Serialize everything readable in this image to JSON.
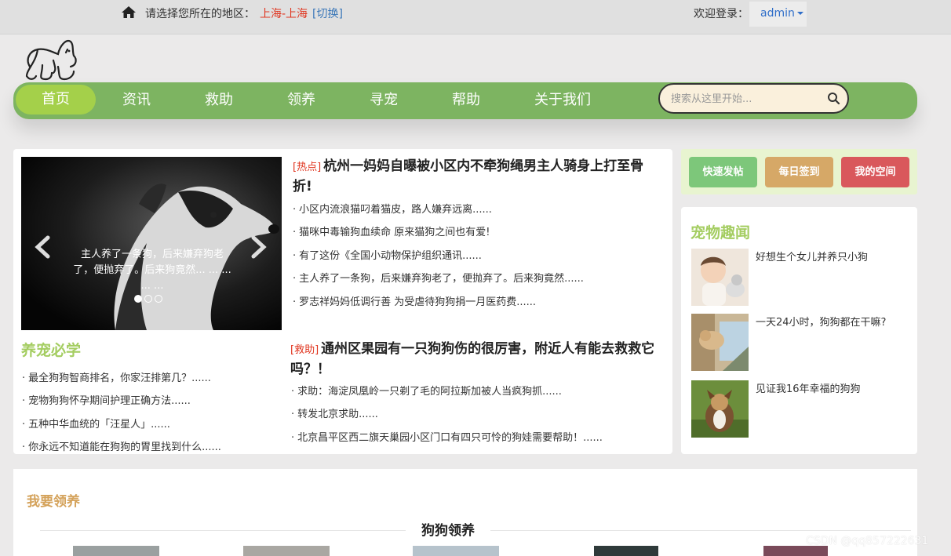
{
  "topbar": {
    "region_label": "请选择您所在的地区：",
    "region_value": "上海-上海",
    "region_switch": "[切换]",
    "welcome": "欢迎登录：",
    "username": "admin"
  },
  "nav": {
    "items": [
      "首页",
      "资讯",
      "救助",
      "领养",
      "寻宠",
      "帮助",
      "关于我们"
    ],
    "active": "首页",
    "search_placeholder": "搜索从这里开始..."
  },
  "carousel": {
    "caption": "主人养了一条狗，后来嫌弃狗老了，便抛弃了。后来狗竟然... ... ... ... ..."
  },
  "must_learn": {
    "title": "养宠必学",
    "items": [
      "最全狗狗智商排名，你家汪排第几？......",
      "宠物狗狗怀孕期间护理正确方法......",
      "五种中华血统的「汪星人」......",
      "你永远不知道能在狗狗的胃里找到什么......"
    ]
  },
  "hot": {
    "tag": "[热点]",
    "headline": "杭州一妈妈自曝被小区内不牵狗绳男主人骑身上打至骨折!",
    "items": [
      "小区内流浪猫叼着猫皮，路人嫌弃远离......",
      "猫咪中毒输狗血续命 原来猫狗之间也有爱!",
      "有了这份《全国小动物保护组织通讯......",
      "主人养了一条狗，后来嫌弃狗老了，便抛弃了。后来狗竟然......",
      "罗志祥妈妈低调行善 为受虐待狗狗捐一月医药费......"
    ]
  },
  "rescue": {
    "tag": "[救助]",
    "headline": "通州区果园有一只狗狗伤的很厉害，附近人有能去救救它吗？！",
    "items": [
      "求助：海淀凤凰岭一只剃了毛的阿拉斯加被人当疯狗抓......",
      "转发北京求助......",
      "北京昌平区西二旗天巢园小区门口有四只可怜的狗娃需要帮助！......"
    ]
  },
  "actions": {
    "quick_post": "快速发帖",
    "daily_checkin": "每日签到",
    "my_space": "我的空间",
    "colors": {
      "quick_post": "#7dc77a",
      "daily_checkin": "#d6a867",
      "my_space": "#d9585c"
    }
  },
  "pet_news": {
    "title": "宠物趣闻",
    "items": [
      "好想生个女儿并养只小狗",
      "一天24小时，狗狗都在干嘛?",
      "见证我16年幸福的狗狗"
    ]
  },
  "adopt": {
    "title": "我要领养",
    "subtitle": "狗狗领养"
  },
  "watermark": "CSDN @qq857222631"
}
